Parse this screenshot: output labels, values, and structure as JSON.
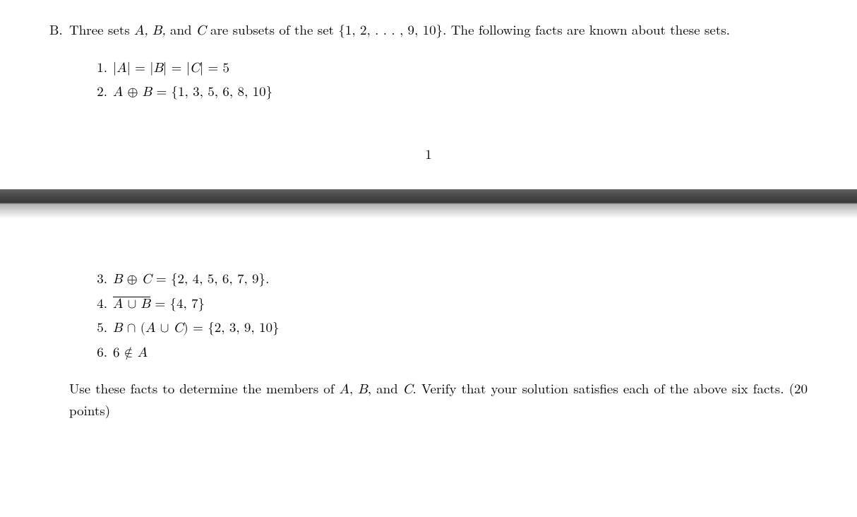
{
  "problem": {
    "label": "B.",
    "intro_before_math": "Three sets ",
    "sets_abc": "A, B, ",
    "and_text": "and ",
    "set_c": "C ",
    "intro_mid": "are subsets of the set ",
    "universe": "{1, 2, . . . , 9, 10}",
    "intro_after": ".  The following facts are known about these sets."
  },
  "facts": [
    {
      "num": "1.",
      "lhs": "|A| = |B| = |C| = 5",
      "rhs": ""
    },
    {
      "num": "2.",
      "lhs": "A ⊕ B = ",
      "rhs": "{1, 3, 5, 6, 8, 10}"
    },
    {
      "num": "3.",
      "lhs": "B ⊕ C = ",
      "rhs": "{2, 4, 5, 6, 7, 9}",
      "tail": "."
    },
    {
      "num": "4.",
      "overline": "A ∪ B",
      "eq": " = ",
      "rhs": "{4, 7}"
    },
    {
      "num": "5.",
      "lhs": "B ∩ (A ∪ C) = ",
      "rhs": "{2, 3, 9, 10}"
    },
    {
      "num": "6.",
      "lhs": "6 ∉ A",
      "rhs": ""
    }
  ],
  "page_number": "1",
  "closing": {
    "line1_before": "Use these facts to determine the members of ",
    "a": "A",
    "comma1": ", ",
    "b": "B",
    "comma2": ", and ",
    "c": "C",
    "line1_after": ".  Verify that your solution satisfies each of the above six facts.  (20 points)"
  }
}
